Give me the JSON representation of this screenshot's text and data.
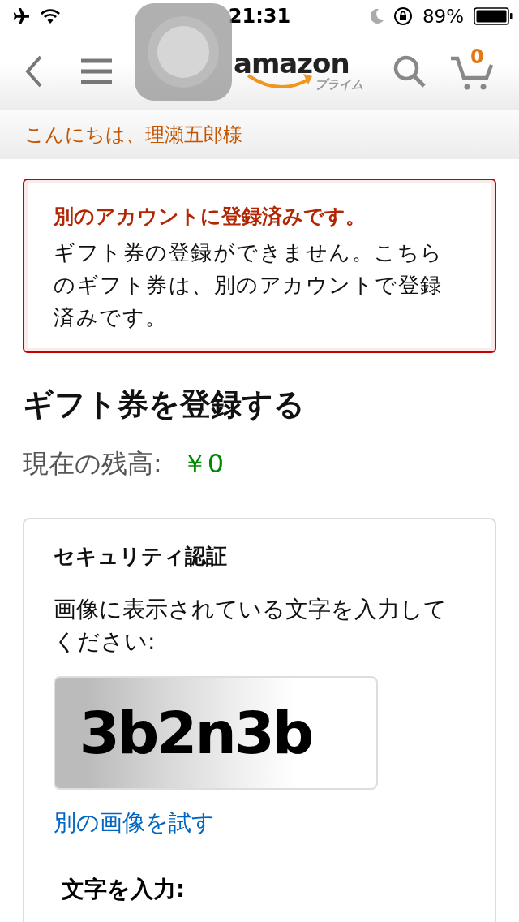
{
  "status_bar": {
    "time": "21:31",
    "battery": "89%"
  },
  "header": {
    "logo": "amazon",
    "logo_sub": "プライム",
    "cart_count": "0"
  },
  "greeting": "こんにちは、理瀬五郎様",
  "alert": {
    "title": "別のアカウントに登録済みです。",
    "message": "ギフト券の登録ができません。こちらのギフト券は、別のアカウントで登録済みです。"
  },
  "page_title": "ギフト券を登録する",
  "balance": {
    "label": "現在の残高:",
    "value": "￥0"
  },
  "security": {
    "title": "セキュリティ認証",
    "instruction": "画像に表示されている文字を入力してください:",
    "captcha": "3b2n3b",
    "retry_link": "別の画像を試す",
    "input_label": "文字を入力:"
  }
}
